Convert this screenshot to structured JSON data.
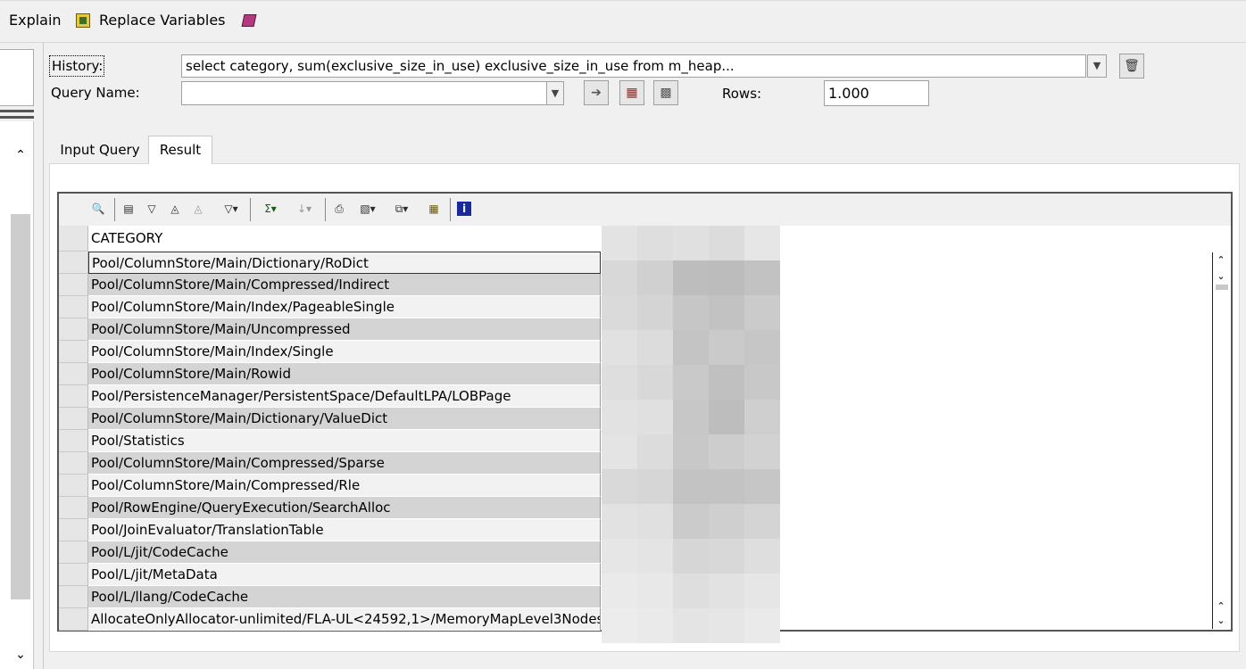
{
  "toolbar": {
    "explain_label": "Explain",
    "replace_variables_label": "Replace Variables",
    "replace_variables_icon": "variables-icon",
    "extra_icon": "book-icon"
  },
  "query": {
    "history_label": "History:",
    "history_value": "select category, sum(exclusive_size_in_use) exclusive_size_in_use from m_heap...",
    "query_name_label": "Query Name:",
    "query_name_value": "",
    "rows_label": "Rows:",
    "rows_value": "1.000"
  },
  "tabs": [
    {
      "label": "Input Query",
      "active": false
    },
    {
      "label": "Result",
      "active": true
    }
  ],
  "grid": {
    "column_header": "CATEGORY",
    "selected_row": 0,
    "rows": [
      "Pool/ColumnStore/Main/Dictionary/RoDict",
      "Pool/ColumnStore/Main/Compressed/Indirect",
      "Pool/ColumnStore/Main/Index/PageableSingle",
      "Pool/ColumnStore/Main/Uncompressed",
      "Pool/ColumnStore/Main/Index/Single",
      "Pool/ColumnStore/Main/Rowid",
      "Pool/PersistenceManager/PersistentSpace/DefaultLPA/LOBPage",
      "Pool/ColumnStore/Main/Dictionary/ValueDict",
      "Pool/Statistics",
      "Pool/ColumnStore/Main/Compressed/Sparse",
      "Pool/ColumnStore/Main/Compressed/Rle",
      "Pool/RowEngine/QueryExecution/SearchAlloc",
      "Pool/JoinEvaluator/TranslationTable",
      "Pool/L/jit/CodeCache",
      "Pool/L/jit/MetaData",
      "Pool/L/llang/CodeCache",
      "AllocateOnlyAllocator-unlimited/FLA-UL<24592,1>/MemoryMapLevel3Nodes"
    ]
  },
  "grid_toolbar_icons": [
    "find-icon",
    "print-preview-icon",
    "filter-icon",
    "binoculars-icon",
    "binoculars-next-icon",
    "filter-dropdown-icon",
    "sum-dropdown-icon",
    "sort-dropdown-icon",
    "print-icon",
    "export-dropdown-icon",
    "copy-dropdown-icon",
    "table-icon",
    "info-icon"
  ],
  "colors": {
    "row_even": "#d4d4d4",
    "row_odd": "#f2f2f2",
    "info_icon": "#1a2a9a"
  }
}
